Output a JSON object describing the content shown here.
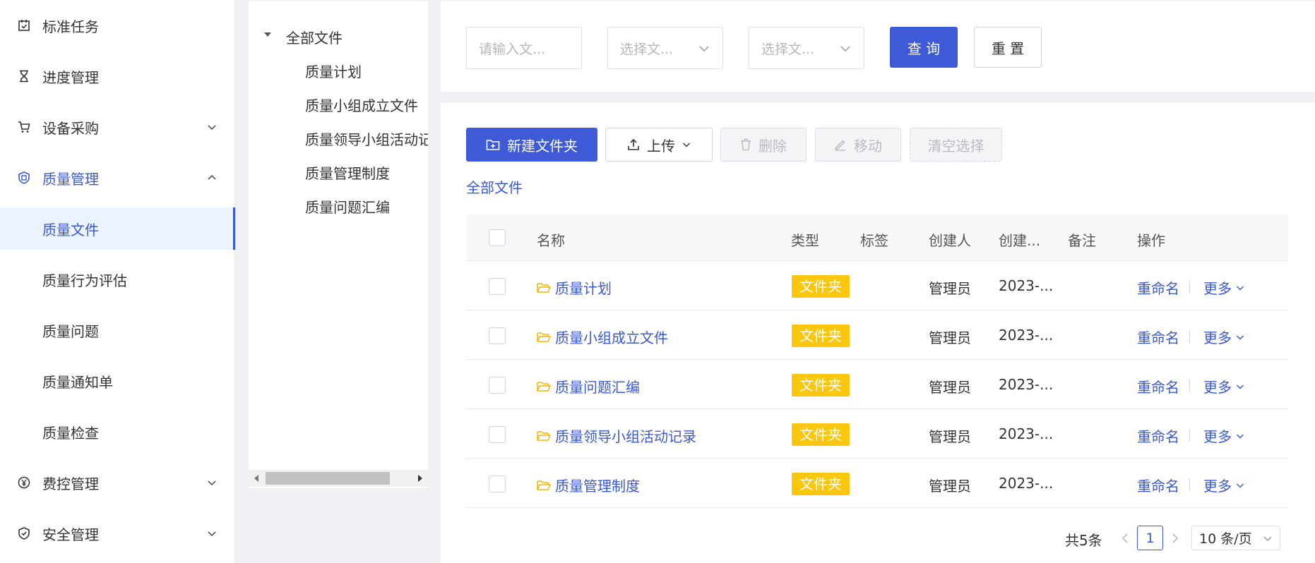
{
  "sidebar": {
    "items": [
      {
        "label": "标准任务",
        "icon": "task-check-icon"
      },
      {
        "label": "进度管理",
        "icon": "hourglass-icon"
      },
      {
        "label": "设备采购",
        "icon": "cart-icon"
      },
      {
        "label": "质量管理",
        "icon": "quality-shield-icon"
      },
      {
        "label": "质量文件"
      },
      {
        "label": "质量行为评估"
      },
      {
        "label": "质量问题"
      },
      {
        "label": "质量通知单"
      },
      {
        "label": "质量检查"
      },
      {
        "label": "费控管理",
        "icon": "yen-icon"
      },
      {
        "label": "安全管理",
        "icon": "safety-shield-icon"
      }
    ]
  },
  "tree": {
    "root": "全部文件",
    "children": [
      "质量计划",
      "质量小组成立文件",
      "质量领导小组活动记录",
      "质量管理制度",
      "质量问题汇编"
    ]
  },
  "filter": {
    "input_placeholder": "请输入文...",
    "select1_placeholder": "选择文...",
    "select2_placeholder": "选择文...",
    "query_label": "查 询",
    "reset_label": "重 置"
  },
  "toolbar": {
    "new_folder": "新建文件夹",
    "upload": "上传",
    "delete": "删除",
    "move": "移动",
    "clear_selection": "清空选择"
  },
  "breadcrumb": "全部文件",
  "table": {
    "headers": [
      "名称",
      "类型",
      "标签",
      "创建人",
      "创建...",
      "备注",
      "操作"
    ],
    "rows": [
      {
        "name": "质量计划",
        "type": "文件夹",
        "creator": "管理员",
        "created": "2023-..."
      },
      {
        "name": "质量小组成立文件",
        "type": "文件夹",
        "creator": "管理员",
        "created": "2023-..."
      },
      {
        "name": "质量问题汇编",
        "type": "文件夹",
        "creator": "管理员",
        "created": "2023-..."
      },
      {
        "name": "质量领导小组活动记录",
        "type": "文件夹",
        "creator": "管理员",
        "created": "2023-..."
      },
      {
        "name": "质量管理制度",
        "type": "文件夹",
        "creator": "管理员",
        "created": "2023-..."
      }
    ],
    "rename_label": "重命名",
    "more_label": "更多"
  },
  "pagination": {
    "total": "共5条",
    "current": "1",
    "page_size": "10 条/页"
  },
  "colors": {
    "primary": "#3e5ad6",
    "tag": "#fbc60e",
    "active_bg": "#eaf3ff"
  }
}
